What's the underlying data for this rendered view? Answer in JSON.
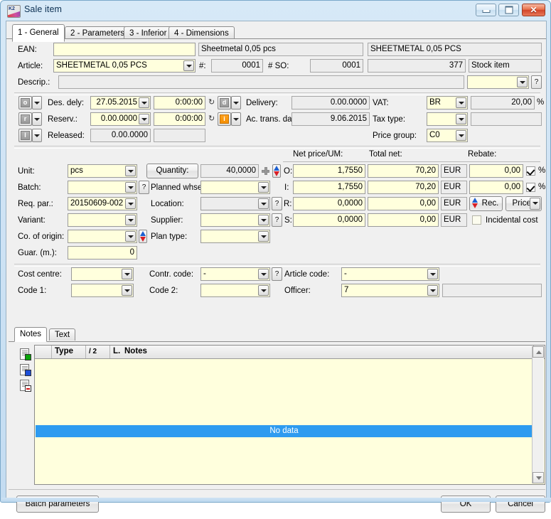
{
  "window": {
    "title": "Sale item",
    "icon": "k2-app-icon",
    "controls": {
      "minimize": "minimize-icon",
      "maximize": "maximize-icon",
      "close": "✕"
    }
  },
  "tabs": [
    {
      "label": "1 - General",
      "active": true
    },
    {
      "label": "2 - Parameters",
      "active": false
    },
    {
      "label": "3 - Inferior",
      "active": false
    },
    {
      "label": "4 - Dimensions",
      "active": false
    }
  ],
  "form": {
    "ean": {
      "label": "EAN:",
      "value": "",
      "desc1": "Sheetmetal 0,05 pcs",
      "desc2": "SHEETMETAL 0,05 PCS"
    },
    "article": {
      "label": "Article:",
      "value": "SHEETMETAL 0,05 PCS",
      "hash_label": "#:",
      "hash_value": "0001",
      "so_label": "# SO:",
      "so_value": "0001",
      "number": "377",
      "type": "Stock item"
    },
    "descrip": {
      "label": "Descrip.:",
      "value": "",
      "combo_value": "",
      "help": "?"
    },
    "des_dely": {
      "flag": "o",
      "label": "Des. dely:",
      "date": "27.05.2015",
      "time": "0:00:00",
      "clock": "↻"
    },
    "reserv": {
      "flag": "r",
      "label": "Reserv.:",
      "date": "0.00.0000",
      "time": "0:00:00",
      "clock": "↻"
    },
    "released": {
      "flag": "l",
      "label": "Released:",
      "date": "0.00.0000",
      "time": ""
    },
    "delivery": {
      "flag": "d",
      "label": "Delivery:",
      "value": "0.00.0000"
    },
    "ac_trans_date": {
      "flag": "i",
      "label": "Ac. trans. date:",
      "value": "9.06.2015"
    },
    "vat": {
      "label": "VAT:",
      "value": "BR",
      "rate": "20,00",
      "pct": "%"
    },
    "tax_type": {
      "label": "Tax type:",
      "value": "",
      "extra": ""
    },
    "price_group": {
      "label": "Price group:",
      "value": "C0"
    },
    "unit": {
      "label": "Unit:",
      "value": "pcs"
    },
    "quantity": {
      "button": "Quantity:",
      "value": "40,0000",
      "plus": "plus-icon"
    },
    "batch": {
      "label": "Batch:",
      "value": "",
      "help": "?"
    },
    "planned_whse": {
      "label": "Planned whse:",
      "value": ""
    },
    "req_par": {
      "label": "Req. par.:",
      "value": "20150609-002"
    },
    "location": {
      "label": "Location:",
      "value": "",
      "help": "?"
    },
    "variant": {
      "label": "Variant:",
      "value": ""
    },
    "supplier": {
      "label": "Supplier:",
      "value": "",
      "help": "?"
    },
    "co_origin": {
      "label": "Co. of origin:",
      "value": ""
    },
    "plan_type": {
      "label": "Plan type:",
      "value": ""
    },
    "guar": {
      "label": "Guar. (m.):",
      "value": "0"
    },
    "cost_centre": {
      "label": "Cost centre:",
      "value": ""
    },
    "contr_code": {
      "label": "Contr. code:",
      "value": "-",
      "help": "?"
    },
    "article_code": {
      "label": "Article code:",
      "value": "-"
    },
    "code1": {
      "label": "Code 1:",
      "value": ""
    },
    "code2": {
      "label": "Code 2:",
      "value": ""
    },
    "officer": {
      "label": "Officer:",
      "value": "7",
      "extra": ""
    }
  },
  "price_table": {
    "headers": {
      "net_price": "Net price/UM:",
      "total_net": "Total net:",
      "rebate": "Rebate:"
    },
    "rows": [
      {
        "key": "O:",
        "net_price": "1,7550",
        "total_net": "70,20",
        "currency": "EUR",
        "rebate": "0,00",
        "pct": "%",
        "checked": true
      },
      {
        "key": "I:",
        "net_price": "1,7550",
        "total_net": "70,20",
        "currency": "EUR",
        "rebate": "0,00",
        "pct": "%",
        "checked": true
      },
      {
        "key": "R:",
        "net_price": "0,0000",
        "total_net": "0,00",
        "currency": "EUR",
        "rebate": "",
        "pct": "",
        "checked": false
      },
      {
        "key": "S:",
        "net_price": "0,0000",
        "total_net": "0,00",
        "currency": "EUR",
        "rebate": "",
        "pct": "",
        "checked": false
      }
    ],
    "rec_button": "Rec.",
    "prices_button": "Prices",
    "incidental_cost": {
      "label": "Incidental cost",
      "checked": false
    }
  },
  "notes": {
    "tabs": [
      {
        "label": "Notes",
        "active": true
      },
      {
        "label": "Text",
        "active": false
      }
    ],
    "side_icons": [
      {
        "name": "add-note-icon"
      },
      {
        "name": "edit-note-icon"
      },
      {
        "name": "delete-note-icon"
      }
    ],
    "grid": {
      "columns": [
        "Type",
        "/ 2",
        "L.",
        "Notes"
      ],
      "empty_message": "No data"
    }
  },
  "footer": {
    "batch_parameters": "Batch parameters",
    "ok": "OK",
    "cancel": "Cancel"
  }
}
